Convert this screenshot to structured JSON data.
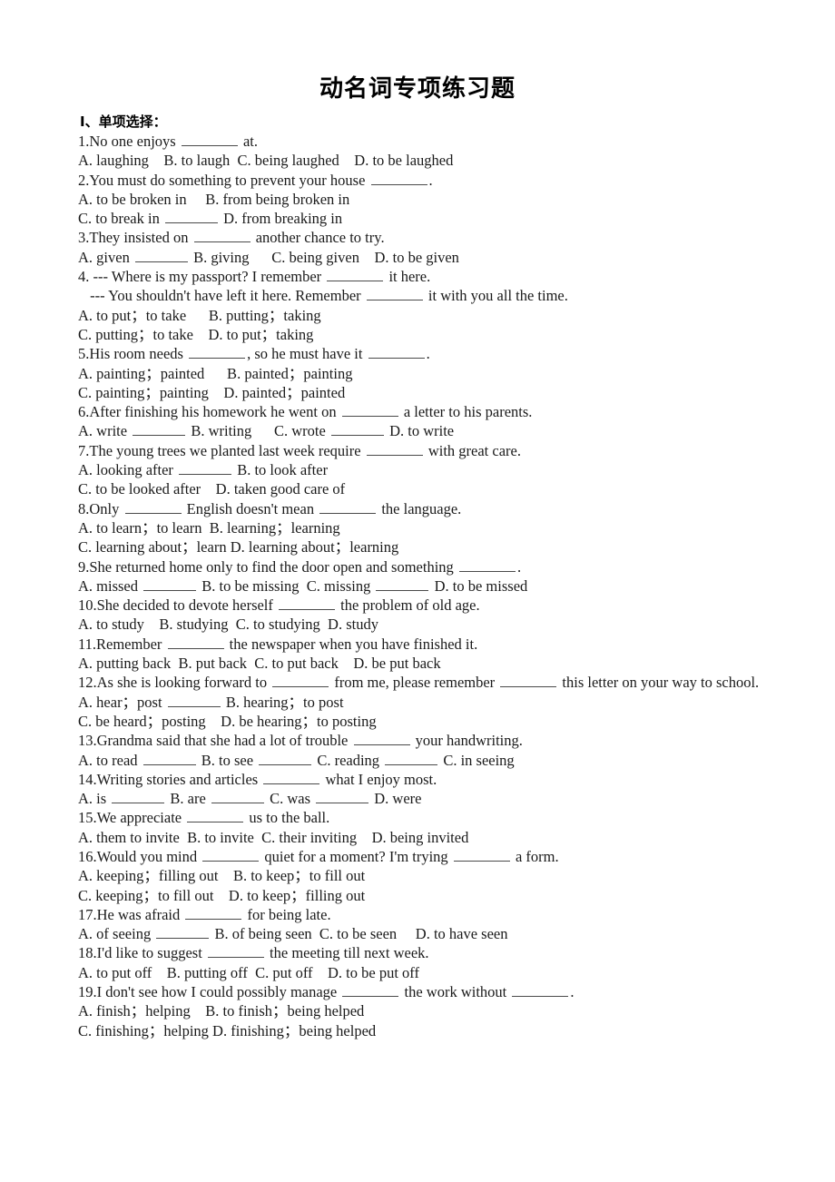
{
  "document": {
    "title": "动名词专项练习题",
    "section_heading": "Ⅰ、单项选择："
  },
  "questions": [
    {
      "stem": "1.No one enjoys        at.",
      "option_lines": [
        "A. laughing    B. to laugh  C. being laughed    D. to be laughed"
      ]
    },
    {
      "stem": "2.You must do something to prevent your house       .",
      "option_lines": [
        "A. to be broken in     B. from being broken in",
        "C. to break in             D. from breaking in"
      ]
    },
    {
      "stem": "3.They insisted on        another chance to try.",
      "option_lines": [
        "A. given          B. giving      C. being given    D. to be given"
      ]
    },
    {
      "stem": "4. --- Where is my passport? I remember        it here.",
      "stem_cont": " --- You shouldn't have left it here. Remember        it with you all the time.",
      "option_lines": [
        "A. to put；to take      B. putting；taking",
        "C. putting；to take    D. to put；taking"
      ]
    },
    {
      "stem": "5.His room needs       , so he must have it       .",
      "option_lines": [
        "A. painting；painted      B. painted；painting",
        "C. painting；painting    D. painted；painted"
      ]
    },
    {
      "stem": "6.After finishing his homework he went on        a letter to his parents.",
      "option_lines": [
        "A. write         B. writing      C. wrote       D. to write"
      ]
    },
    {
      "stem": "7.The young trees we planted last week require        with great care.",
      "option_lines": [
        "A. looking after         B. to look after",
        "C. to be looked after    D. taken good care of"
      ]
    },
    {
      "stem": "8.Only        English doesn't mean        the language.",
      "option_lines": [
        "A. to learn；to learn  B. learning；learning",
        "C. learning about；learn D. learning about；learning"
      ]
    },
    {
      "stem": "9.She returned home only to find the door open and something       .",
      "option_lines": [
        "A. missed       B. to be missing  C. missing       D. to be missed"
      ]
    },
    {
      "stem": "10.She decided to devote herself        the problem of old age.",
      "option_lines": [
        "A. to study    B. studying  C. to studying  D. study"
      ]
    },
    {
      "stem": "11.Remember        the newspaper when you have finished it.",
      "option_lines": [
        "A. putting back  B. put back  C. to put back    D. be put back"
      ]
    },
    {
      "stem": "12.As she is looking forward to        from me, please remember        this letter on your way to school.",
      "option_lines": [
        "A. hear；post               B. hearing；to post",
        "C. be heard；posting    D. be hearing；to posting"
      ]
    },
    {
      "stem": "13.Grandma said that she had a lot of trouble        your handwriting.",
      "option_lines": [
        "A. to read        B. to see         C. reading         C. in seeing"
      ]
    },
    {
      "stem": "14.Writing stories and articles        what I enjoy most.",
      "option_lines": [
        "A. is          B. are        C. was        D. were"
      ]
    },
    {
      "stem": "15.We appreciate        us to the ball.",
      "option_lines": [
        "A. them to invite  B. to invite  C. their inviting    D. being invited"
      ]
    },
    {
      "stem": "16.Would you mind        quiet for a moment? I'm trying        a form.",
      "option_lines": [
        "A. keeping；filling out    B. to keep；to fill out",
        "C. keeping；to fill out    D. to keep；filling out"
      ]
    },
    {
      "stem": "17.He was afraid        for being late.",
      "option_lines": [
        "A. of seeing       B. of being seen  C. to be seen     D. to have seen"
      ]
    },
    {
      "stem": "18.I'd like to suggest        the meeting till next week.",
      "option_lines": [
        "A. to put off    B. putting off  C. put off    D. to be put off"
      ]
    },
    {
      "stem": "19.I don't see how I could possibly manage        the work without       .",
      "option_lines": [
        "A. finish；helping    B. to finish；being helped",
        "C. finishing；helping D. finishing；being helped"
      ]
    }
  ]
}
